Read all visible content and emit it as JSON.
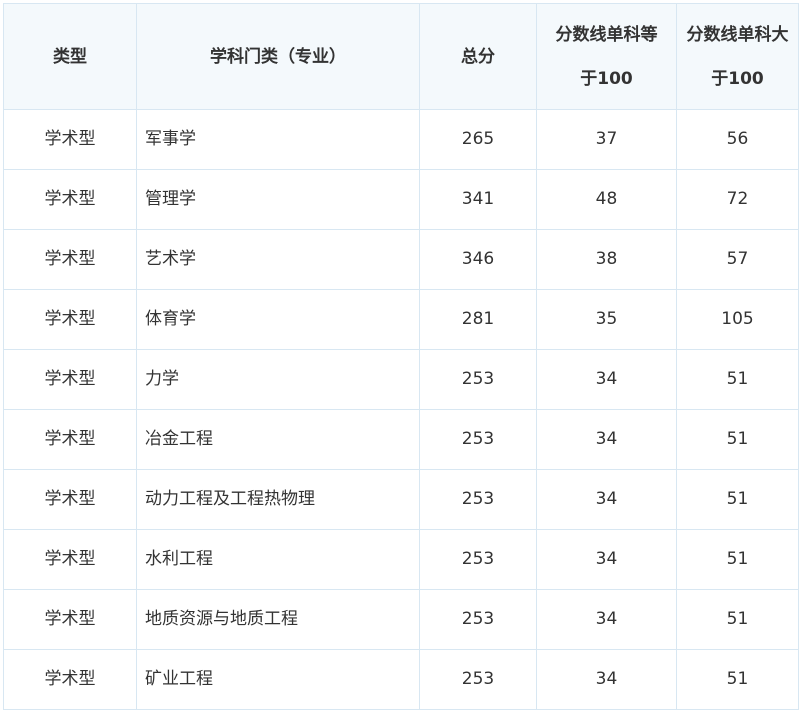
{
  "table": {
    "headers": [
      "类型",
      "学科门类（专业）",
      "总分",
      "分数线单科等于100",
      "分数线单科大于100"
    ],
    "rows": [
      [
        "学术型",
        "军事学",
        "265",
        "37",
        "56"
      ],
      [
        "学术型",
        "管理学",
        "341",
        "48",
        "72"
      ],
      [
        "学术型",
        "艺术学",
        "346",
        "38",
        "57"
      ],
      [
        "学术型",
        "体育学",
        "281",
        "35",
        "105"
      ],
      [
        "学术型",
        "力学",
        "253",
        "34",
        "51"
      ],
      [
        "学术型",
        "冶金工程",
        "253",
        "34",
        "51"
      ],
      [
        "学术型",
        "动力工程及工程热物理",
        "253",
        "34",
        "51"
      ],
      [
        "学术型",
        "水利工程",
        "253",
        "34",
        "51"
      ],
      [
        "学术型",
        "地质资源与地质工程",
        "253",
        "34",
        "51"
      ],
      [
        "学术型",
        "矿业工程",
        "253",
        "34",
        "51"
      ]
    ]
  }
}
